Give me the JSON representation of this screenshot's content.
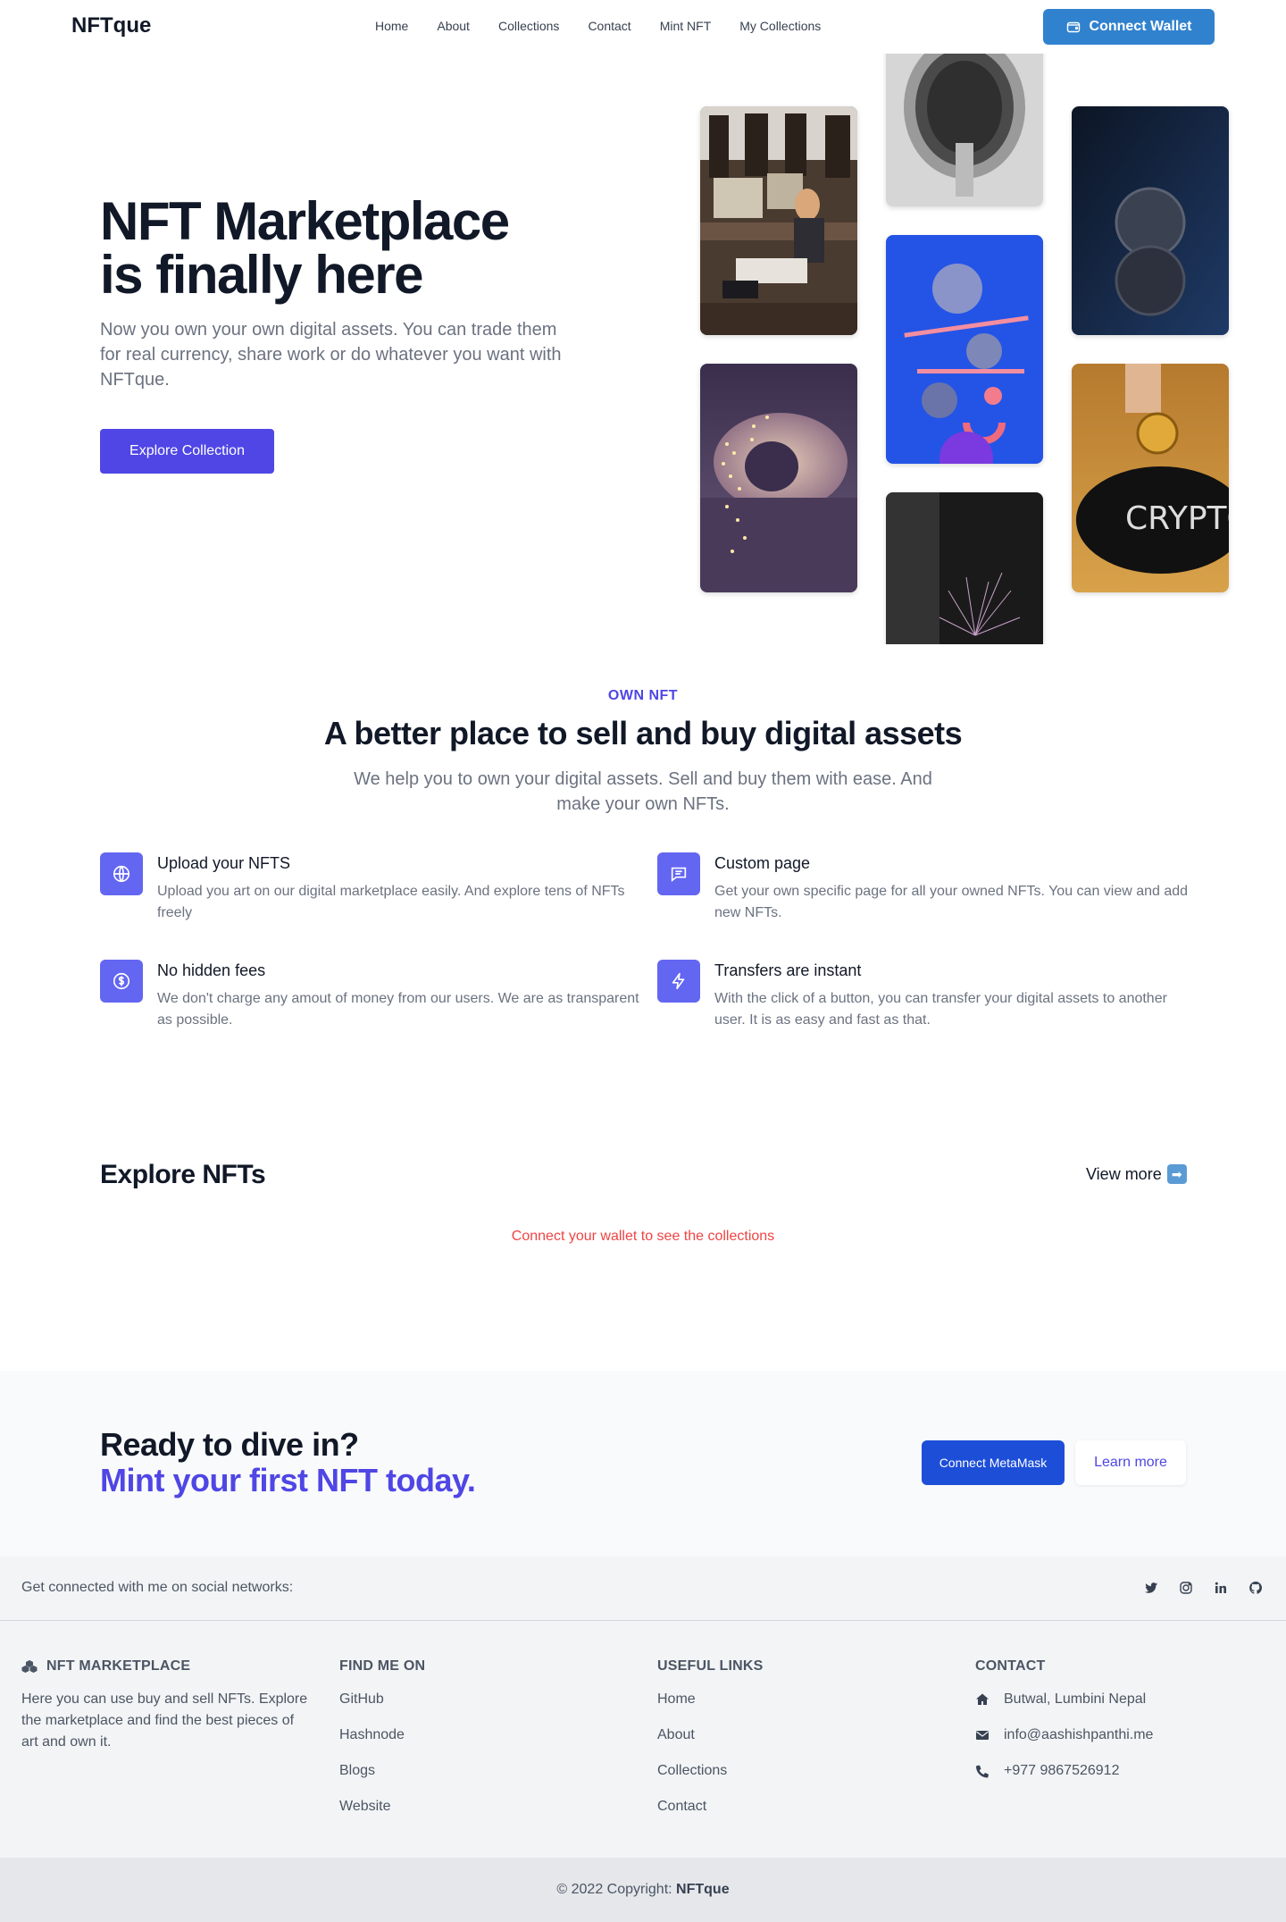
{
  "nav": {
    "brand": "NFTque",
    "links": [
      "Home",
      "About",
      "Collections",
      "Contact",
      "Mint NFT",
      "My Collections"
    ],
    "wallet_button": "Connect Wallet"
  },
  "hero": {
    "title_line1": "NFT Marketplace",
    "title_line2": "is finally here",
    "subtitle": "Now you own your own digital assets. You can trade them for real currency, share work or do whatever you want with NFTque.",
    "cta": "Explore Collection"
  },
  "features": {
    "eyebrow": "OWN NFT",
    "title": "A better place to sell and buy digital assets",
    "subtitle": "We help you to own your digital assets. Sell and buy them with ease. And make your own NFTs.",
    "items": [
      {
        "title": "Upload your NFTS",
        "desc": "Upload you art on our digital marketplace easily. And explore tens of NFTs freely",
        "icon": "globe-icon"
      },
      {
        "title": "Custom page",
        "desc": "Get your own specific page for all your owned NFTs. You can view and add new NFTs.",
        "icon": "chat-icon"
      },
      {
        "title": "No hidden fees",
        "desc": "We don't charge any amout of money from our users. We are as transparent as possible.",
        "icon": "dollar-icon"
      },
      {
        "title": "Transfers are instant",
        "desc": "With the click of a button, you can transfer your digital assets to another user. It is as easy and fast as that.",
        "icon": "lightning-icon"
      }
    ]
  },
  "explore": {
    "title": "Explore NFTs",
    "view_more": "View more",
    "arrow": "➡",
    "message": "Connect your wallet to see the collections"
  },
  "cta": {
    "line1": "Ready to dive in?",
    "line2": "Mint your first NFT today.",
    "primary": "Connect MetaMask",
    "secondary": "Learn more"
  },
  "footer": {
    "social_text": "Get connected with me on social networks:",
    "social_icons": [
      "twitter-icon",
      "instagram-icon",
      "linkedin-icon",
      "github-icon"
    ],
    "col1": {
      "title": "NFT MARKETPLACE",
      "body": "Here you can use buy and sell NFTs. Explore the marketplace and find the best pieces of art and own it."
    },
    "col2": {
      "title": "FIND ME ON",
      "links": [
        "GitHub",
        "Hashnode",
        "Blogs",
        "Website"
      ]
    },
    "col3": {
      "title": "USEFUL LINKS",
      "links": [
        "Home",
        "About",
        "Collections",
        "Contact"
      ]
    },
    "col4": {
      "title": "CONTACT",
      "items": [
        "Butwal, Lumbini Nepal",
        "info@aashishpanthi.me",
        "+977 9867526912"
      ]
    },
    "copyright_prefix": "© 2022 Copyright:",
    "copyright_brand": "NFTque"
  },
  "colors": {
    "accent": "#4f46e5",
    "wallet_blue": "#3182ce",
    "icon_bg": "#6366f1",
    "error": "#ef4444"
  }
}
